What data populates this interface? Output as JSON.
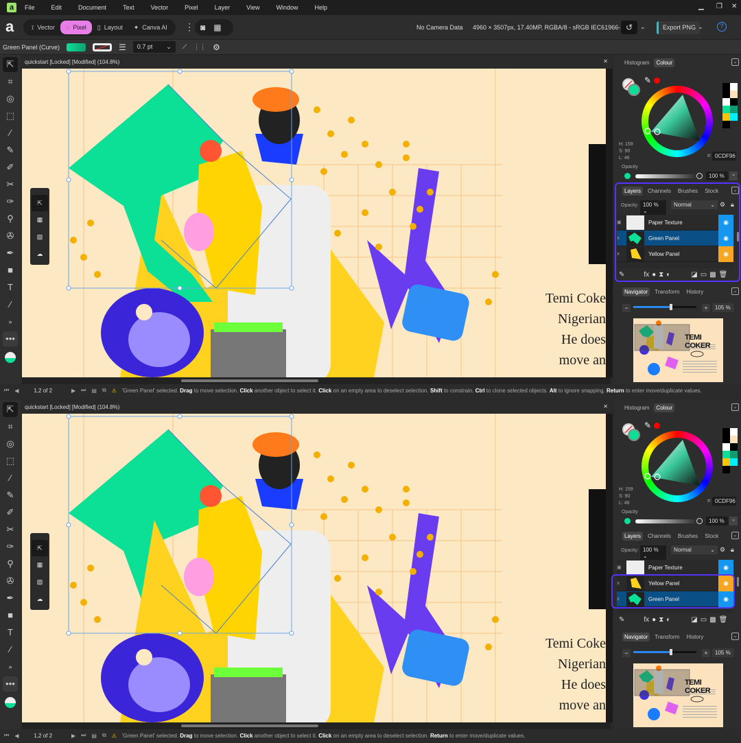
{
  "menu": [
    "File",
    "Edit",
    "Document",
    "Text",
    "Vector",
    "Pixel",
    "Layer",
    "View",
    "Window",
    "Help"
  ],
  "app_logo": "a",
  "personas": [
    "Vector",
    "Pixel",
    "Layout",
    "Canva AI"
  ],
  "active_persona": "Pixel",
  "doc_info": {
    "camera": "No Camera Data",
    "specs": "4960 × 3507px, 17.40MP, RGBA/8 - sRGB IEC61966-2.1",
    "export": "Export PNG"
  },
  "context": {
    "selection": "Green Panel (Curve)",
    "stroke_width": "0.7 pt",
    "fill_color": "#0CDF96"
  },
  "panes": [
    {
      "doc_title": "quickstart [Locked] [Modified] (104.8%)",
      "page": "1,2 of 2",
      "status": [
        {
          "t": "'Green Panel' selected. ",
          "b": false
        },
        {
          "t": "Drag",
          "b": true
        },
        {
          "t": " to move selection. ",
          "b": false
        },
        {
          "t": "Click",
          "b": true
        },
        {
          "t": " another object to select it. ",
          "b": false
        },
        {
          "t": "Click",
          "b": true
        },
        {
          "t": " on an empty area to deselect selection. ",
          "b": false
        },
        {
          "t": "Shift",
          "b": true
        },
        {
          "t": " to constrain. ",
          "b": false
        },
        {
          "t": "Ctrl",
          "b": true
        },
        {
          "t": " to clone selected objects. ",
          "b": false
        },
        {
          "t": "Alt",
          "b": true
        },
        {
          "t": " to ignore snapping. ",
          "b": false
        },
        {
          "t": "Return",
          "b": true
        },
        {
          "t": " to enter move/duplicate values.",
          "b": false
        }
      ],
      "layers": [
        {
          "name": "Paper Texture",
          "selected": false,
          "eye": "blue"
        },
        {
          "name": "Green Panel",
          "selected": true,
          "eye": "blue"
        },
        {
          "name": "Yellow Panel",
          "selected": false,
          "eye": "orange"
        }
      ]
    },
    {
      "doc_title": "quickstart [Locked] [Modified] (104.8%)",
      "page": "1,2 of 2",
      "status": [
        {
          "t": "'Green Panel' selected. ",
          "b": false
        },
        {
          "t": "Drag",
          "b": true
        },
        {
          "t": " to move selection. ",
          "b": false
        },
        {
          "t": "Click",
          "b": true
        },
        {
          "t": " another object to select it. ",
          "b": false
        },
        {
          "t": "Click",
          "b": true
        },
        {
          "t": " on an empty area to deselect selection. ",
          "b": false
        },
        {
          "t": "Return",
          "b": true
        },
        {
          "t": " to enter move/duplicate values.",
          "b": false
        }
      ],
      "layers": [
        {
          "name": "Paper Texture",
          "selected": false,
          "eye": "blue"
        },
        {
          "name": "Yellow Panel",
          "selected": false,
          "eye": "orange"
        },
        {
          "name": "Green Panel",
          "selected": true,
          "eye": "blue"
        }
      ]
    }
  ],
  "colour_panel": {
    "tabs": [
      "Histogram",
      "Colour"
    ],
    "active": "Colour",
    "h": "H: 159",
    "s": "S: 90",
    "l": "L: 46",
    "hex_label": "#:",
    "hex": "0CDF96",
    "opacity_label": "Opacity",
    "opacity": "100 %"
  },
  "layers_panel": {
    "tabs": [
      "Layers",
      "Channels",
      "Brushes",
      "Stock"
    ],
    "opacity_label": "Opacity:",
    "opacity": "100 %",
    "blend": "Normal"
  },
  "navigator_panel": {
    "tabs": [
      "Navigator",
      "Transform",
      "History"
    ],
    "zoom": "105 %",
    "zoom_fraction": 0.6,
    "thumb_title": "TEMI COKER"
  },
  "canvas_text": [
    "Temi Coke",
    "Nigerian",
    "He does",
    "move an"
  ],
  "colors": {
    "accent": "#e87fe8",
    "selection": "#0a4f86",
    "highlight": "#5533ff",
    "canvas": "#fde8c4",
    "green_panel": "#0CDF96",
    "yellow_panel": "#ffd21f",
    "purple": "#6a3cf0"
  }
}
